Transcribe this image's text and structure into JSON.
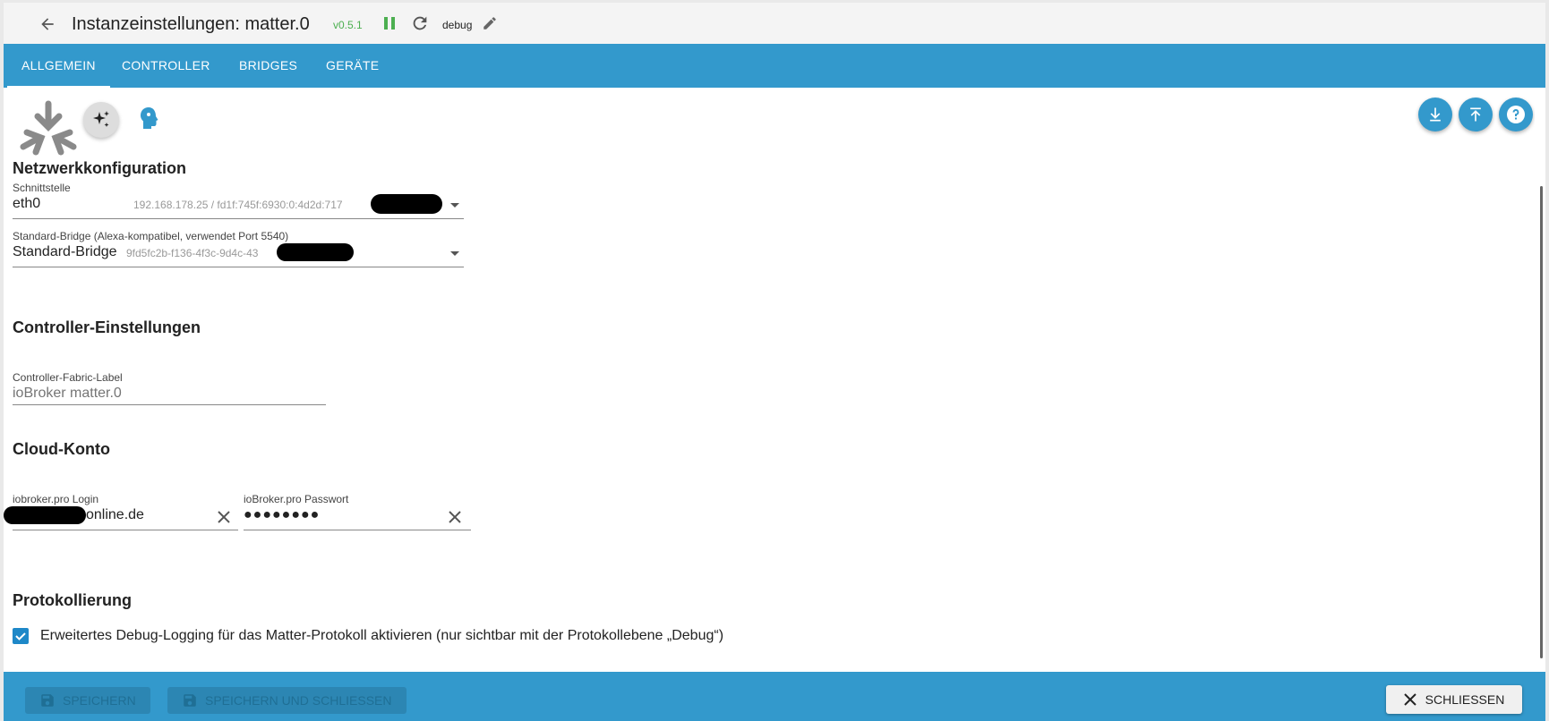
{
  "header": {
    "title": "Instanzeinstellungen: matter.0",
    "version": "v0.5.1",
    "log_level": "debug"
  },
  "tabs": [
    {
      "label": "ALLGEMEIN",
      "active": true
    },
    {
      "label": "CONTROLLER",
      "active": false
    },
    {
      "label": "BRIDGES",
      "active": false
    },
    {
      "label": "GERÄTE",
      "active": false
    }
  ],
  "network": {
    "title": "Netzwerkkonfiguration",
    "interface": {
      "label": "Schnittstelle",
      "value": "eth0",
      "detail": "192.168.178.25 / fd1f:745f:6930:0:4d2d:717"
    },
    "bridge": {
      "label": "Standard-Bridge (Alexa-kompatibel, verwendet Port 5540)",
      "value": "Standard-Bridge",
      "detail": "9fd5fc2b-f136-4f3c-9d4c-43"
    }
  },
  "controller": {
    "title": "Controller-Einstellungen",
    "fabric_label": {
      "label": "Controller-Fabric-Label",
      "placeholder": "ioBroker matter.0"
    }
  },
  "cloud": {
    "title": "Cloud-Konto",
    "login": {
      "label": "iobroker.pro Login",
      "value": "online.de"
    },
    "password": {
      "label": "ioBroker.pro Passwort",
      "value": "●●●●●●●●"
    }
  },
  "logging": {
    "title": "Protokollierung",
    "checkbox_label": "Erweitertes Debug-Logging für das Matter-Protokoll aktivieren (nur sichtbar mit der Protokollebene „Debug“)",
    "checked": true
  },
  "footer": {
    "save_label": "SPEICHERN",
    "save_close_label": "SPEICHERN UND SCHLIESSEN",
    "close_label": "SCHLIESSEN"
  },
  "colors": {
    "accent": "#3399cc",
    "version_green": "#4caf50"
  }
}
